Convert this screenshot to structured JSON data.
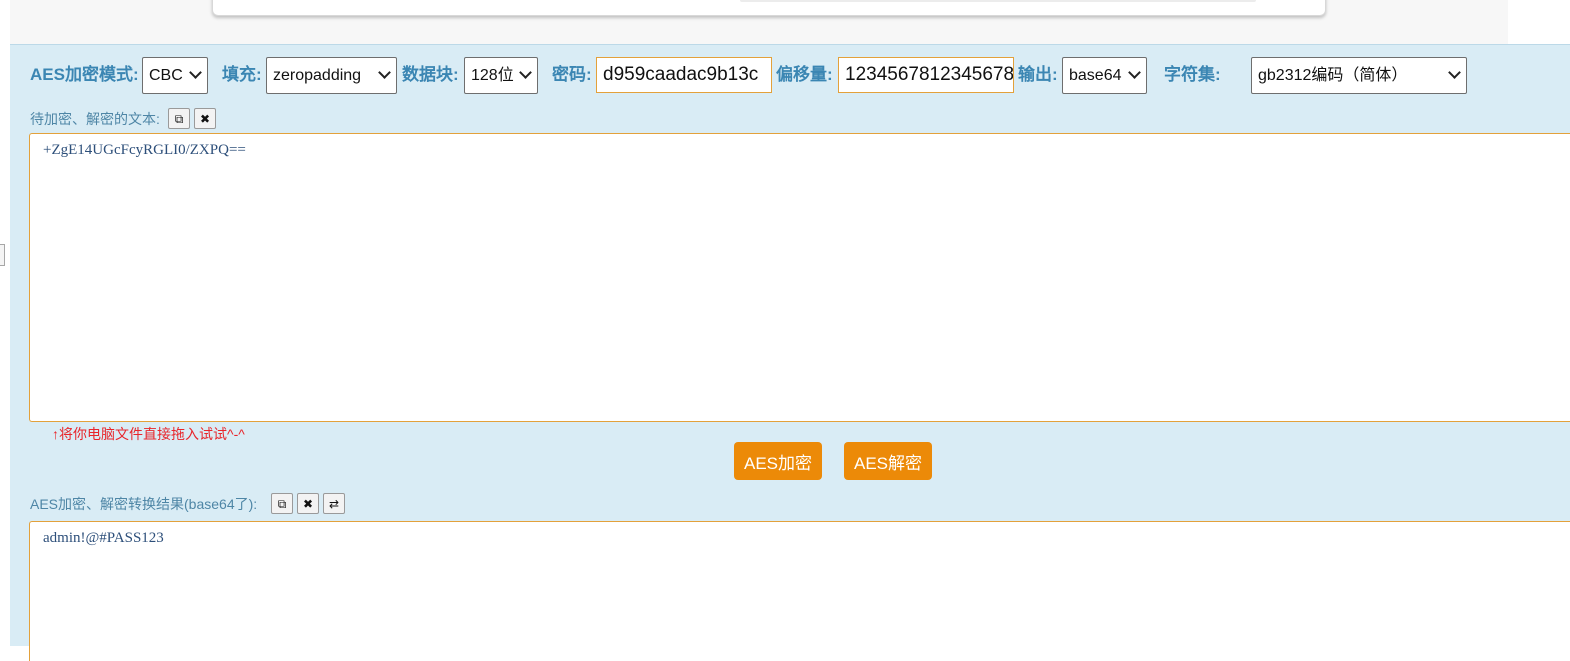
{
  "toolbar": {
    "mode_label": "AES加密模式:",
    "mode_value": "CBC",
    "padding_label": "填充:",
    "padding_value": "zeropadding",
    "block_label": "数据块:",
    "block_value": "128位",
    "password_label": "密码:",
    "password_value": "d959caadac9b13c",
    "iv_label": "偏移量:",
    "iv_value": "1234567812345678",
    "output_label": "输出:",
    "output_value": "base64",
    "charset_label": "字符集:",
    "charset_value": "gb2312编码（简体）"
  },
  "input": {
    "label": "待加密、解密的文本:",
    "copy_icon": "copy-icon",
    "clear_icon": "clear-icon",
    "value": "+ZgE14UGcFcyRGLI0/ZXPQ==",
    "hint": "↑将你电脑文件直接拖入试试^-^"
  },
  "actions": {
    "encrypt_label": "AES加密",
    "decrypt_label": "AES解密",
    "button_color": "#ec8a08"
  },
  "output": {
    "label": "AES加密、解密转换结果(base64了):",
    "copy_icon": "copy-icon",
    "clear_icon": "clear-icon",
    "swap_icon": "swap-icon",
    "value": "admin!@#PASS123"
  },
  "colors": {
    "panel_bg": "#d9ecf5",
    "label_blue": "#3b86b3",
    "field_border": "#e3a13b",
    "hint_red": "#e8262b"
  }
}
